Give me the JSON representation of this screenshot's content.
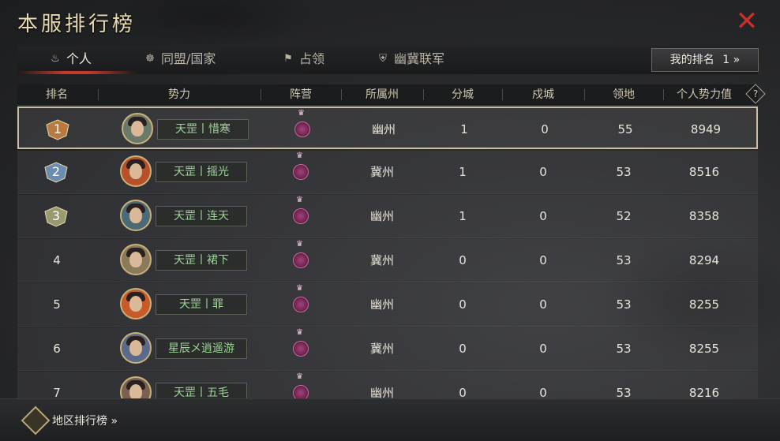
{
  "title": "本服排行榜",
  "tabs": [
    {
      "label": "个人",
      "icon": "flame-icon",
      "active": true
    },
    {
      "label": "同盟/国家",
      "icon": "alliance-icon",
      "active": false
    },
    {
      "label": "占领",
      "icon": "flag-icon",
      "active": false
    },
    {
      "label": "幽冀联军",
      "icon": "army-icon",
      "active": false
    }
  ],
  "my_rank_label": "我的排名",
  "my_rank_value": "1 »",
  "columns": [
    "排名",
    "势力",
    "阵营",
    "所属州",
    "分城",
    "戍城",
    "领地",
    "个人势力值"
  ],
  "help_label": "?",
  "rows": [
    {
      "rank": "1",
      "name": "天罡丨惜寒",
      "state": "幽州",
      "branch": "1",
      "garrison": "0",
      "territory": "55",
      "power": "8949"
    },
    {
      "rank": "2",
      "name": "天罡丨摇光",
      "state": "冀州",
      "branch": "1",
      "garrison": "0",
      "territory": "53",
      "power": "8516"
    },
    {
      "rank": "3",
      "name": "天罡丨连天",
      "state": "幽州",
      "branch": "1",
      "garrison": "0",
      "territory": "52",
      "power": "8358"
    },
    {
      "rank": "4",
      "name": "天罡丨裙下",
      "state": "冀州",
      "branch": "0",
      "garrison": "0",
      "territory": "53",
      "power": "8294"
    },
    {
      "rank": "5",
      "name": "天罡丨罪",
      "state": "幽州",
      "branch": "0",
      "garrison": "0",
      "territory": "53",
      "power": "8255"
    },
    {
      "rank": "6",
      "name": "星辰メ逍遥游",
      "state": "冀州",
      "branch": "0",
      "garrison": "0",
      "territory": "53",
      "power": "8255"
    },
    {
      "rank": "7",
      "name": "天罡丨五毛",
      "state": "幽州",
      "branch": "0",
      "garrison": "0",
      "territory": "53",
      "power": "8216"
    }
  ],
  "footer_label": "地区排行榜 »",
  "colors": {
    "accent_red": "#c8392c",
    "name_green": "#9ed39a",
    "gold": "#c9b27a"
  }
}
